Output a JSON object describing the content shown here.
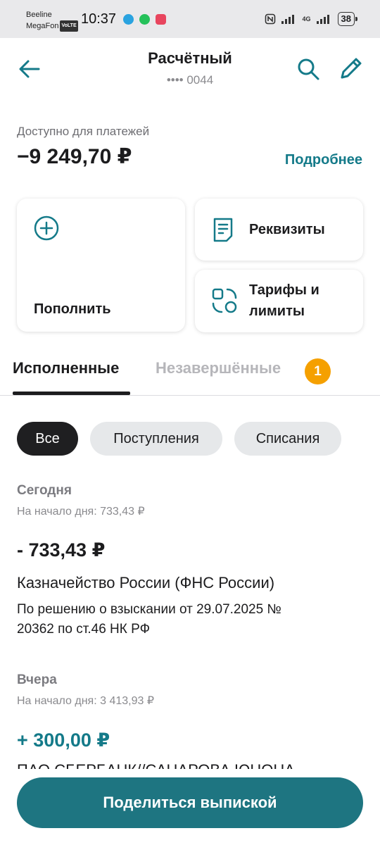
{
  "status_bar": {
    "carrier1": "Beeline",
    "carrier2": "MegaFon",
    "volte": "VoLTE",
    "time": "10:37",
    "network": "4G",
    "battery": "38"
  },
  "header": {
    "title": "Расчётный",
    "account_mask": "•••• 0044"
  },
  "balance": {
    "label": "Доступно для платежей",
    "value": "−9 249,70 ₽",
    "details_link": "Подробнее"
  },
  "actions": {
    "topup": "Пополнить",
    "requisites": "Реквизиты",
    "tariffs_line1": "Тарифы и",
    "tariffs_line2": "лимиты"
  },
  "tabs": {
    "completed": "Исполненные",
    "pending": "Незавершённые",
    "pending_count": "1"
  },
  "filters": {
    "all": "Все",
    "incoming": "Поступления",
    "outgoing": "Списания"
  },
  "days": [
    {
      "title": "Сегодня",
      "opening": "На начало дня: 733,43 ₽",
      "tx": {
        "amount": "- 733,43 ₽",
        "name": "Казначейство России (ФНС России)",
        "desc_line1": "По решению о взыскании от 29.07.2025 №",
        "desc_line2": "20362 по ст.46 НК РФ"
      }
    },
    {
      "title": "Вчера",
      "opening": "На начало дня: 3 413,93 ₽",
      "tx": {
        "amount": "+ 300,00 ₽",
        "name_partial": "ПАО СБЕРБАНК//САНАРОВА ЮНОНА"
      }
    }
  ],
  "share_button": "Поделиться выпиской",
  "colors": {
    "accent": "#147a89",
    "button": "#1e7581",
    "badge": "#f5a000"
  }
}
